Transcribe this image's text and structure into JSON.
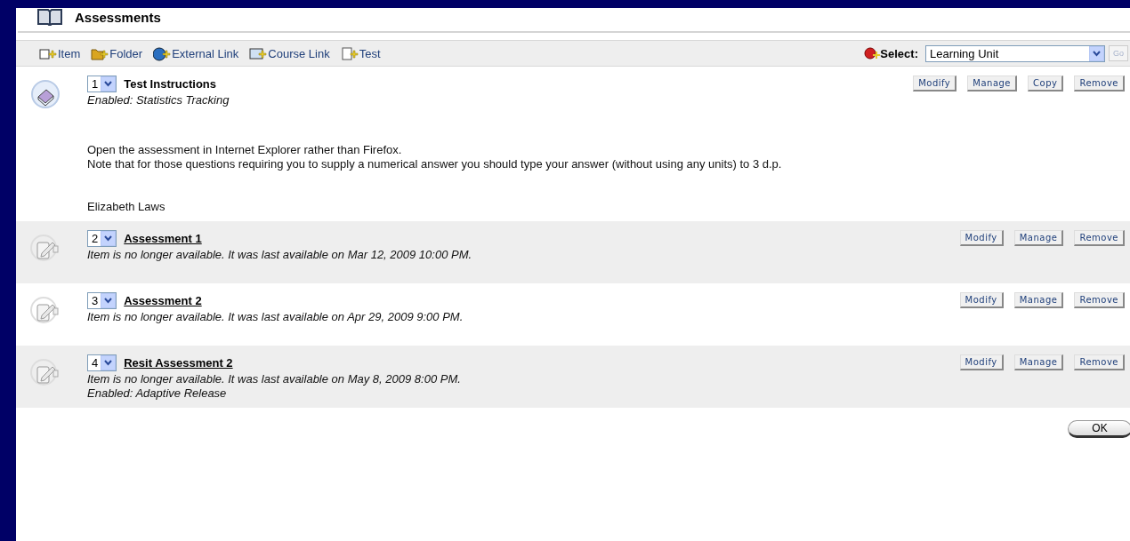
{
  "page": {
    "title": "Assessments"
  },
  "toolbar": {
    "actions": [
      {
        "label": "Item",
        "kind": "item"
      },
      {
        "label": "Folder",
        "kind": "folder"
      },
      {
        "label": "External Link",
        "kind": "globe"
      },
      {
        "label": "Course Link",
        "kind": "course"
      },
      {
        "label": "Test",
        "kind": "test"
      }
    ],
    "select": {
      "label": "Select:",
      "value": "Learning Unit",
      "go": "Go",
      "disabled": true
    }
  },
  "items": [
    {
      "kind": "item",
      "order": "1",
      "title": "Test Instructions",
      "link": false,
      "details": [
        "Enabled: Statistics Tracking"
      ],
      "description": [
        "Open the assessment in Internet Explorer rather than Firefox.",
        "Note that for those questions requiring you to supply a numerical answer you should type your answer (without using any units) to 3 d.p.",
        "Elizabeth Laws"
      ],
      "buttons": [
        "Modify",
        "Manage",
        "Copy",
        "Remove"
      ]
    },
    {
      "kind": "test",
      "order": "2",
      "title": "Assessment 1",
      "link": true,
      "details": [
        "Item is no longer available. It was last available on Mar 12, 2009 10:00 PM."
      ],
      "buttons": [
        "Modify",
        "Manage",
        "Remove"
      ]
    },
    {
      "kind": "test",
      "order": "3",
      "title": "Assessment 2",
      "link": true,
      "details": [
        "Item is no longer available. It was last available on Apr 29, 2009 9:00 PM."
      ],
      "buttons": [
        "Modify",
        "Manage",
        "Remove"
      ]
    },
    {
      "kind": "test",
      "order": "4",
      "title": "Resit Assessment 2",
      "link": true,
      "details": [
        "Item is no longer available. It was last available on May 8, 2009 8:00 PM.",
        "Enabled: Adaptive Release"
      ],
      "buttons": [
        "Modify",
        "Manage",
        "Remove"
      ]
    }
  ],
  "ok": "OK"
}
